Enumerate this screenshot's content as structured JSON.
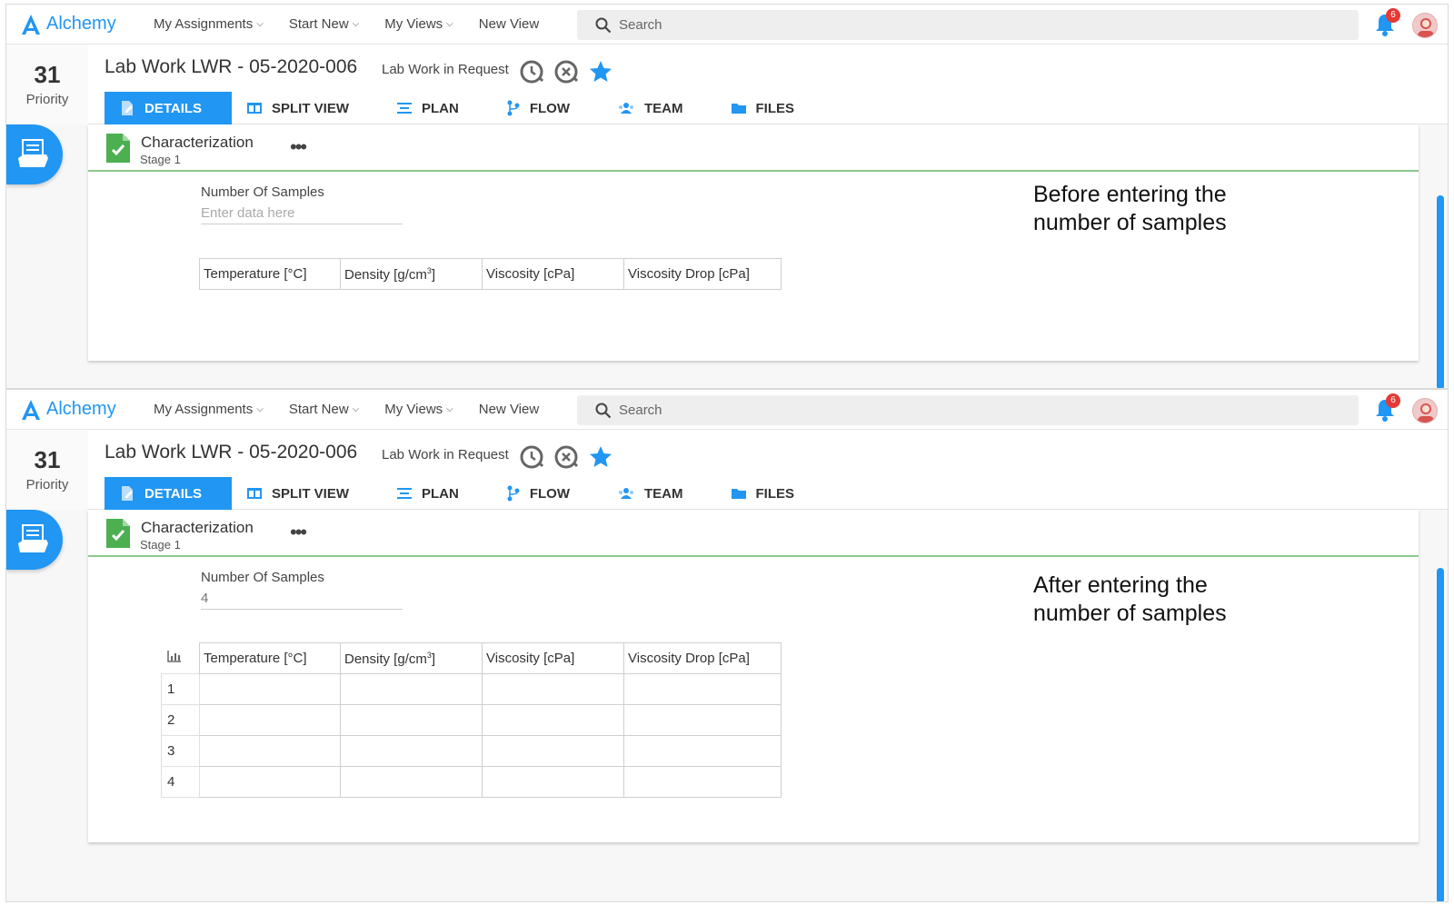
{
  "brand": {
    "name": "Alchemy",
    "accent": "#2196f3"
  },
  "nav": {
    "items": [
      "My Assignments",
      "Start New",
      "My Views",
      "New View"
    ],
    "search_placeholder": "Search",
    "notification_count": "6"
  },
  "record": {
    "priority_number": "31",
    "priority_label": "Priority",
    "title": "Lab Work LWR - 05-2020-006",
    "status": "Lab Work in Request"
  },
  "tabs": [
    "DETAILS",
    "SPLIT VIEW",
    "PLAN",
    "FLOW",
    "TEAM",
    "FILES"
  ],
  "stage": {
    "title": "Characterization",
    "subtitle": "Stage 1",
    "more": "•••"
  },
  "field": {
    "label": "Number Of Samples",
    "placeholder": "Enter data here"
  },
  "table": {
    "headers": [
      "Temperature [°C]",
      "Density [g/cm",
      "Viscosity [cPa]",
      "Viscosity Drop [cPa]"
    ],
    "density_superscript": "3",
    "density_suffix": "]"
  },
  "before": {
    "note": "Before entering the\nnumber of samples"
  },
  "after": {
    "note": "After entering the\nnumber of samples",
    "value": "4",
    "rows": [
      "1",
      "2",
      "3",
      "4"
    ]
  }
}
